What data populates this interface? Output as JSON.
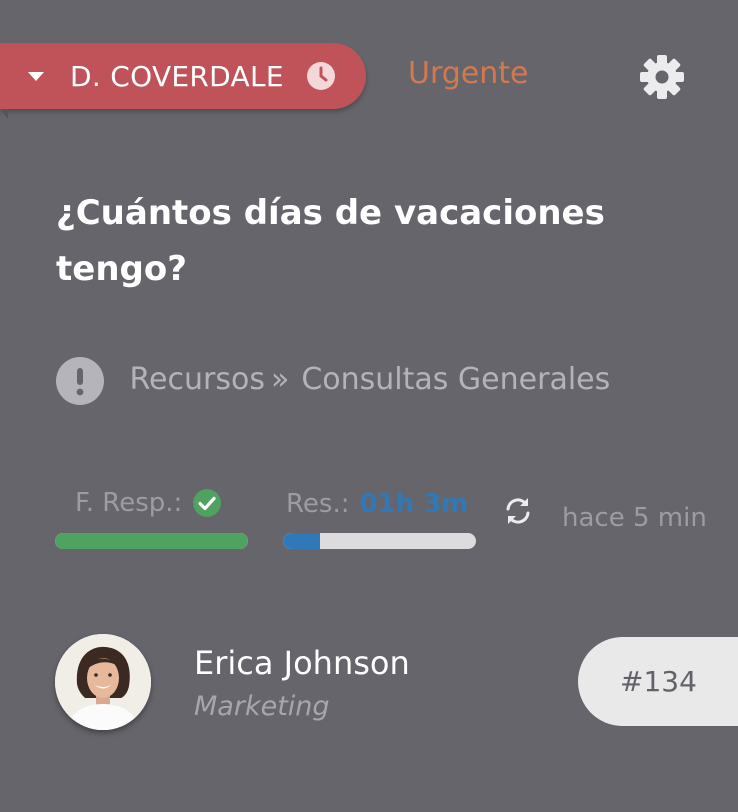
{
  "header": {
    "assignee": "D. COVERDALE",
    "priority": "Urgente",
    "priority_color": "#d2794f",
    "assignee_color": "#c0535a",
    "icons": [
      "chevron-down-icon",
      "clock-icon",
      "gear-icon"
    ]
  },
  "ticket": {
    "title": "¿Cuántos días de vacaciones tengo?",
    "breadcrumb": {
      "parent": "n Recursos",
      "separator": "»",
      "child": "Consultas Generales"
    },
    "id": "#134"
  },
  "sla": {
    "first_response": {
      "label": "F. Resp.:",
      "status": "met",
      "progress": 1.0,
      "color": "#4fa25f"
    },
    "resolution": {
      "label": "Res.:",
      "time": "01h 3m",
      "progress": 0.19,
      "color": "#2f79b8"
    },
    "updated": "hace 5 min"
  },
  "requester": {
    "name": "Erica Johnson",
    "department": "Marketing"
  }
}
